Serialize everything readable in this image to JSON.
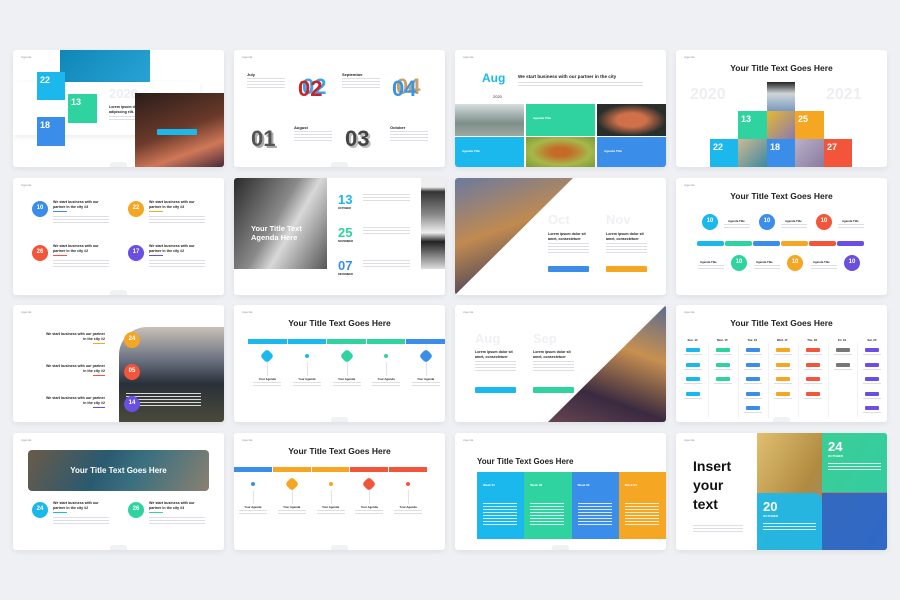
{
  "colors": {
    "cyan": "#1ab8ec",
    "green": "#2fd3a0",
    "blue": "#3a8de8",
    "orange": "#f5a623",
    "red": "#f2553a",
    "purple": "#6a4fe0",
    "gray": "#777777"
  },
  "agenda_label": "Agenda",
  "generic_title": "Your Title Text Goes Here",
  "s1": {
    "year": "2020",
    "heading": "Lorem ipsum dolor sit amet, consectetuer adipiscing elit.",
    "d1": "22",
    "d2": "13",
    "d3": "18"
  },
  "s2": {
    "m1": "July",
    "m2": "September",
    "m3": "August",
    "m4": "October",
    "n1": "01",
    "n2": "02",
    "n3": "03",
    "n4": "04"
  },
  "s3": {
    "month": "Aug",
    "year": "2020",
    "heading": "We start business with our partner in the city",
    "tile": "Agenda Title"
  },
  "s4": {
    "y1": "2020",
    "y2": "2021",
    "d": [
      "13",
      "25",
      "22",
      "18",
      "27"
    ]
  },
  "s5": {
    "items": [
      {
        "n": "10",
        "t": "We start business with our partner in the city #3"
      },
      {
        "n": "22",
        "t": "We start business with our partner in the city #3"
      },
      {
        "n": "26",
        "t": "We start business with our partner in the city #2"
      },
      {
        "n": "17",
        "t": "We start business with our partner in the city #2"
      }
    ]
  },
  "s6": {
    "title": "Your Title Text Agenda Here",
    "dates": [
      {
        "n": "13",
        "m": "OCTOBER"
      },
      {
        "n": "25",
        "m": "NOVEMBER"
      },
      {
        "n": "07",
        "m": "DECEMBER"
      }
    ]
  },
  "s7": {
    "m1": "Oct",
    "m2": "Nov",
    "heading": "Lorem ipsum dolor sit amet, consectetuer"
  },
  "s8": {
    "num": "10",
    "item": "Agenda Title"
  },
  "s9": {
    "items": [
      {
        "n": "24",
        "t": "We start business with our partner in the city #2"
      },
      {
        "n": "05",
        "t": "We start business with our partner in the city #2"
      },
      {
        "n": "14",
        "t": "We start business with our partner in the city #2"
      }
    ]
  },
  "s10": {
    "item": "Your Agenda"
  },
  "s11": {
    "m1": "Aug",
    "m2": "Sep",
    "heading": "Lorem ipsum dolor sit amet, consectetuer"
  },
  "s12": {
    "days": [
      "Sun. 14",
      "Mon. 15",
      "Tue. 16",
      "Wed. 17",
      "Thu. 18",
      "Fri. 19",
      "Sat. 20"
    ],
    "counts": [
      4,
      3,
      5,
      4,
      4,
      2,
      5
    ]
  },
  "s13": {
    "items": [
      {
        "n": "24",
        "t": "We start business with our partner in the city #2"
      },
      {
        "n": "26",
        "t": "We start business with our partner in the city #3"
      }
    ]
  },
  "s14": {
    "item": "Your Agenda"
  },
  "s15": {
    "weeks": [
      "Week 01",
      "Week 02",
      "Week 03",
      "Week 04"
    ]
  },
  "s16": {
    "heading": "Insert your text",
    "d1": "24",
    "m1": "OCTOBER",
    "d2": "20",
    "m2": "OCTOBER"
  }
}
